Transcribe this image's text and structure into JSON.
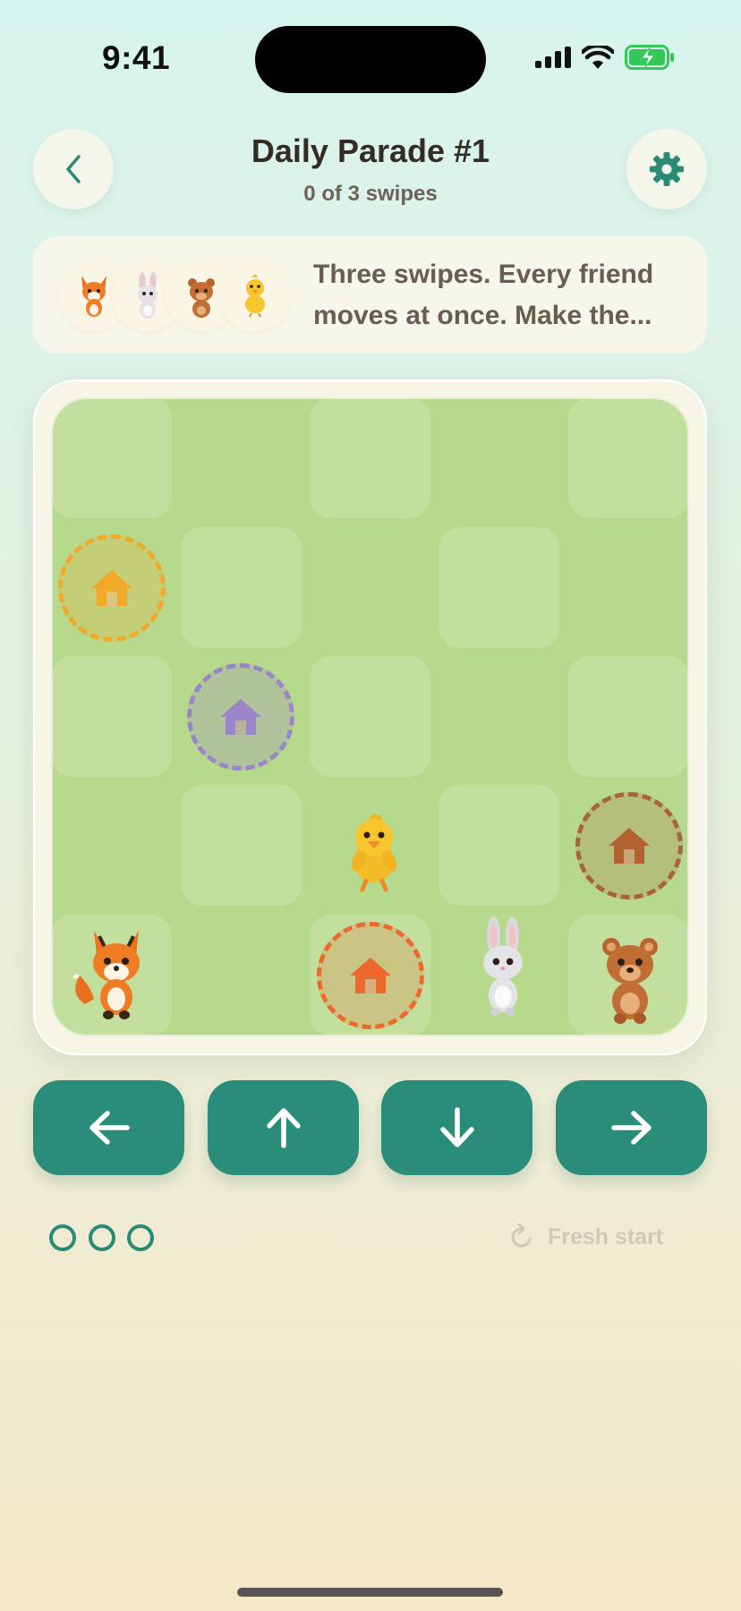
{
  "status_bar": {
    "time": "9:41"
  },
  "header": {
    "title": "Daily Parade #1",
    "subtitle": "0 of 3 swipes"
  },
  "intro": {
    "friends": [
      "fox",
      "bunny",
      "bear",
      "chick"
    ],
    "text": "Three swipes. Every friend moves at once. Make the..."
  },
  "board": {
    "rows": 5,
    "cols": 5,
    "homes": [
      {
        "color": "#f2a92a",
        "row": 1,
        "col": 0,
        "owner": "chick"
      },
      {
        "color": "#9a86c9",
        "row": 2,
        "col": 1,
        "owner": "bunny"
      },
      {
        "color": "#a9643a",
        "row": 3,
        "col": 4,
        "owner": "bear"
      },
      {
        "color": "#ee6a2c",
        "row": 4,
        "col": 2,
        "owner": "fox"
      }
    ],
    "critters": [
      {
        "name": "chick",
        "row": 3,
        "col": 2
      },
      {
        "name": "fox",
        "row": 4,
        "col": 0
      },
      {
        "name": "bunny",
        "row": 4,
        "col": 3
      },
      {
        "name": "bear",
        "row": 4,
        "col": 4
      }
    ]
  },
  "controls": {
    "arrows": [
      "left",
      "up",
      "down",
      "right"
    ]
  },
  "swipes": {
    "total": 3,
    "used": 0
  },
  "fresh_start": {
    "label": "Fresh start",
    "icon": "refresh-icon"
  },
  "colors": {
    "accent": "#2a8d79",
    "board": "#b7d98c"
  }
}
